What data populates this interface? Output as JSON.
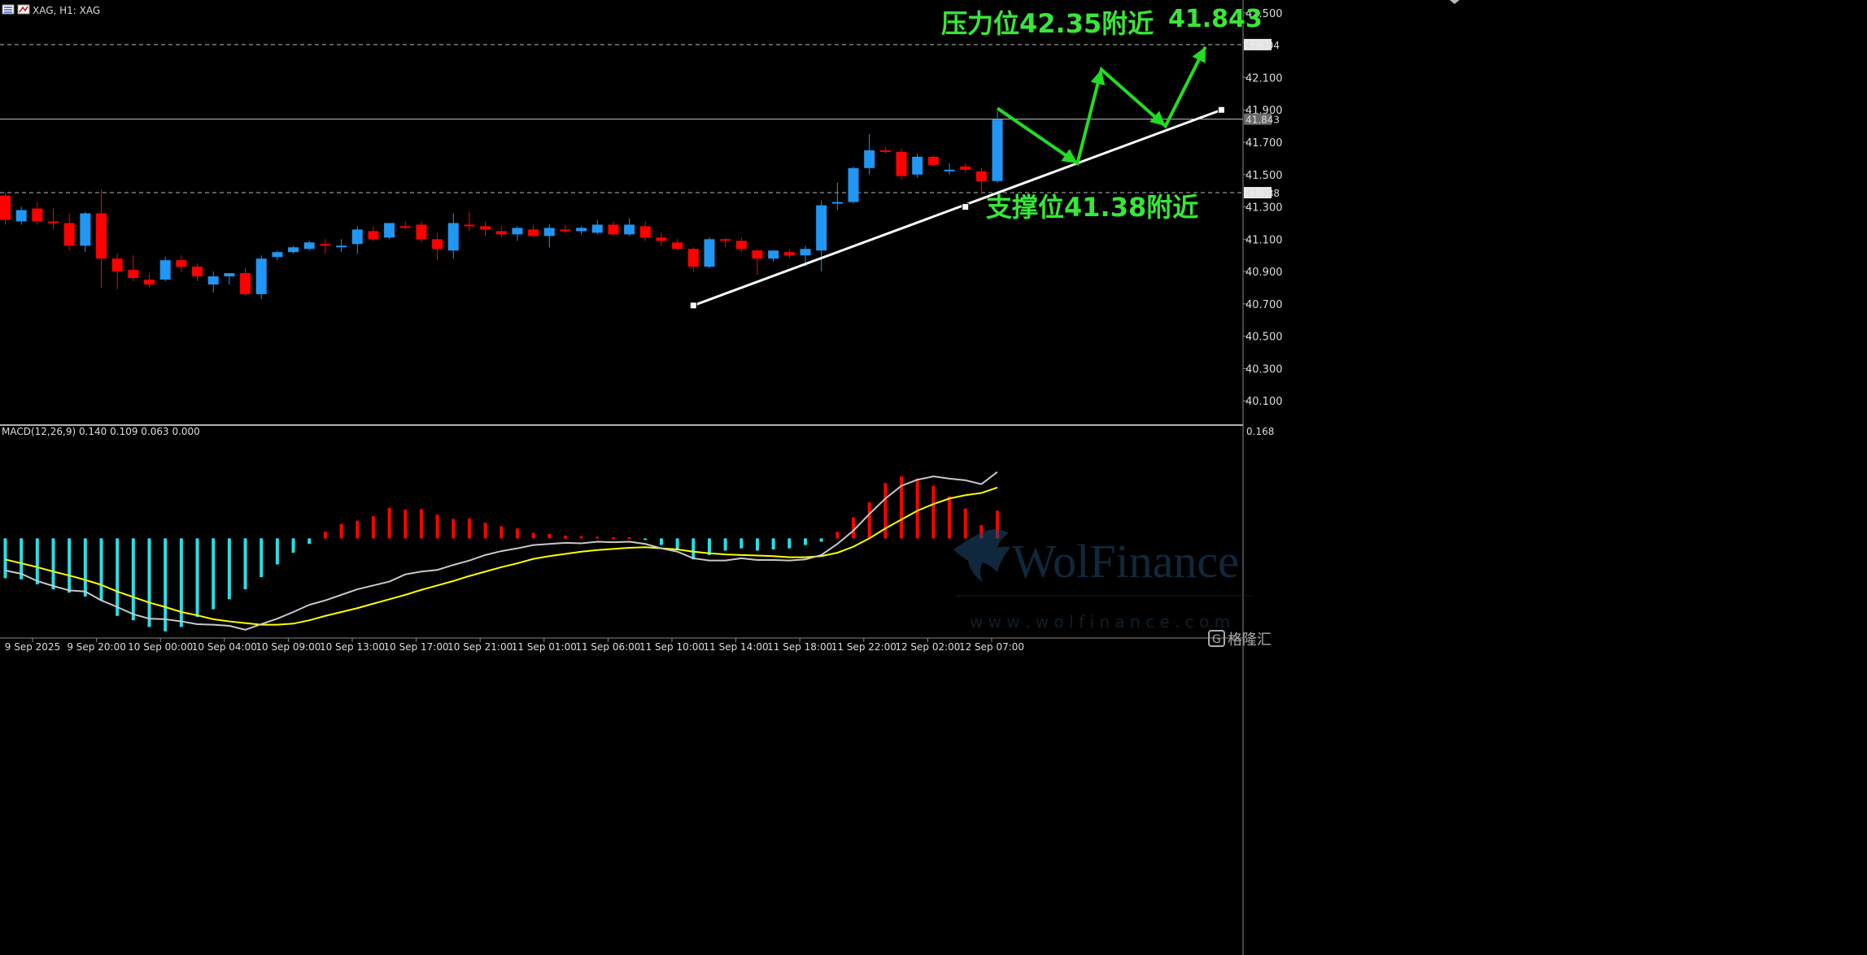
{
  "header": {
    "symbol_label": "XAG, H1: XAG"
  },
  "indicator": {
    "label": "MACD(12,26,9) 0.140 0.109 0.063 0.000",
    "axis_max_label": "0.168"
  },
  "watermark": {
    "brand": "WolFinance",
    "url": "w w w . w o l f i n a n c e . c o m",
    "corner_logo": "格隆汇"
  },
  "annotations": {
    "resistance": "压力位42.35附近",
    "support": "支撑位41.38附近",
    "target": "41.843"
  },
  "colors": {
    "bull": "#2196f3",
    "bear": "#ff0000",
    "macd_hist_pos": "#ff0000",
    "macd_hist_neg": "#26e0e8",
    "macd_line": "#c8c8c8",
    "signal_line": "#ffff00",
    "annotation_green": "#39e639",
    "arrow_green": "#22dd22"
  },
  "chart_data": {
    "type": "candlestick",
    "price_axis": {
      "range": [
        39.95,
        42.58
      ],
      "ticks": [
        "42.500",
        "42.100",
        "41.900",
        "41.700",
        "41.500",
        "41.300",
        "41.100",
        "40.900",
        "40.700",
        "40.500",
        "40.300",
        "40.100"
      ]
    },
    "price_markers": [
      {
        "value": 42.304,
        "label": "42.304",
        "style": "dashed"
      },
      {
        "value": 41.843,
        "label": "41.843",
        "style": "solid"
      },
      {
        "value": 41.388,
        "label": "41.388",
        "style": "dashed"
      }
    ],
    "time_labels": [
      "9 Sep 2025",
      "9 Sep 20:00",
      "10 Sep 00:00",
      "10 Sep 04:00",
      "10 Sep 09:00",
      "10 Sep 13:00",
      "10 Sep 17:00",
      "10 Sep 21:00",
      "11 Sep 01:00",
      "11 Sep 06:00",
      "11 Sep 10:00",
      "11 Sep 14:00",
      "11 Sep 18:00",
      "11 Sep 22:00",
      "12 Sep 02:00",
      "12 Sep 07:00"
    ],
    "candles": [
      [
        41.37,
        41.39,
        41.19,
        41.22
      ],
      [
        41.21,
        41.3,
        41.19,
        41.28
      ],
      [
        41.29,
        41.33,
        41.19,
        41.21
      ],
      [
        41.21,
        41.29,
        41.16,
        41.2
      ],
      [
        41.2,
        41.26,
        41.03,
        41.06
      ],
      [
        41.06,
        41.27,
        41.02,
        41.26
      ],
      [
        41.26,
        41.41,
        40.8,
        40.98
      ],
      [
        40.98,
        41.01,
        40.79,
        40.9
      ],
      [
        40.91,
        41.0,
        40.84,
        40.86
      ],
      [
        40.85,
        40.89,
        40.8,
        40.82
      ],
      [
        40.85,
        40.99,
        40.84,
        40.97
      ],
      [
        40.97,
        41.0,
        40.9,
        40.93
      ],
      [
        40.93,
        40.95,
        40.84,
        40.87
      ],
      [
        40.82,
        40.9,
        40.77,
        40.87
      ],
      [
        40.87,
        40.89,
        40.82,
        40.89
      ],
      [
        40.89,
        40.92,
        40.75,
        40.76
      ],
      [
        40.76,
        41.0,
        40.73,
        40.98
      ],
      [
        40.99,
        41.03,
        40.97,
        41.02
      ],
      [
        41.02,
        41.06,
        41.01,
        41.05
      ],
      [
        41.04,
        41.09,
        41.03,
        41.08
      ],
      [
        41.07,
        41.1,
        41.01,
        41.06
      ],
      [
        41.06,
        41.1,
        41.02,
        41.06
      ],
      [
        41.07,
        41.18,
        41.01,
        41.16
      ],
      [
        41.15,
        41.18,
        41.09,
        41.1
      ],
      [
        41.11,
        41.2,
        41.1,
        41.2
      ],
      [
        41.18,
        41.21,
        41.16,
        41.17
      ],
      [
        41.19,
        41.21,
        41.08,
        41.1
      ],
      [
        41.1,
        41.14,
        40.97,
        41.04
      ],
      [
        41.03,
        41.26,
        40.98,
        41.2
      ],
      [
        41.19,
        41.27,
        41.15,
        41.18
      ],
      [
        41.18,
        41.21,
        41.12,
        41.16
      ],
      [
        41.15,
        41.18,
        41.11,
        41.13
      ],
      [
        41.13,
        41.18,
        41.09,
        41.17
      ],
      [
        41.16,
        41.19,
        41.11,
        41.12
      ],
      [
        41.12,
        41.19,
        41.05,
        41.17
      ],
      [
        41.16,
        41.19,
        41.14,
        41.15
      ],
      [
        41.15,
        41.18,
        41.13,
        41.17
      ],
      [
        41.14,
        41.22,
        41.13,
        41.19
      ],
      [
        41.19,
        41.21,
        41.12,
        41.13
      ],
      [
        41.13,
        41.23,
        41.12,
        41.19
      ],
      [
        41.18,
        41.21,
        41.09,
        41.11
      ],
      [
        41.11,
        41.14,
        41.06,
        41.09
      ],
      [
        41.08,
        41.1,
        41.03,
        41.04
      ],
      [
        41.04,
        41.05,
        40.9,
        40.93
      ],
      [
        40.93,
        41.11,
        40.92,
        41.1
      ],
      [
        41.1,
        41.11,
        41.05,
        41.09
      ],
      [
        41.09,
        41.11,
        41.02,
        41.04
      ],
      [
        41.03,
        41.04,
        40.88,
        40.98
      ],
      [
        40.98,
        41.03,
        40.96,
        41.03
      ],
      [
        41.02,
        41.04,
        40.98,
        41.0
      ],
      [
        41.0,
        41.06,
        40.93,
        41.04
      ],
      [
        41.03,
        41.34,
        40.9,
        41.31
      ],
      [
        41.32,
        41.45,
        41.28,
        41.33
      ],
      [
        41.33,
        41.55,
        41.32,
        41.54
      ],
      [
        41.54,
        41.75,
        41.5,
        41.65
      ],
      [
        41.65,
        41.67,
        41.63,
        41.64
      ],
      [
        41.64,
        41.66,
        41.47,
        41.49
      ],
      [
        41.5,
        41.63,
        41.48,
        41.61
      ],
      [
        41.61,
        41.62,
        41.55,
        41.56
      ],
      [
        41.53,
        41.57,
        41.5,
        41.53
      ],
      [
        41.55,
        41.57,
        41.51,
        41.53
      ],
      [
        41.52,
        41.54,
        41.38,
        41.46
      ],
      [
        41.46,
        41.89,
        41.45,
        41.84
      ]
    ],
    "trend_line": {
      "from": [
        43,
        40.69
      ],
      "mid": [
        60,
        41.3
      ],
      "to": [
        76,
        41.9
      ]
    },
    "forecast_path": [
      [
        62,
        41.91
      ],
      [
        67,
        41.57
      ],
      [
        68.5,
        42.15
      ],
      [
        72.5,
        41.8
      ],
      [
        75,
        42.29
      ]
    ],
    "macd": {
      "range": [
        -0.18,
        0.168
      ],
      "histogram": [
        -0.072,
        -0.074,
        -0.083,
        -0.092,
        -0.098,
        -0.105,
        -0.112,
        -0.14,
        -0.148,
        -0.16,
        -0.168,
        -0.16,
        -0.142,
        -0.128,
        -0.11,
        -0.092,
        -0.07,
        -0.047,
        -0.026,
        -0.01,
        0.012,
        0.026,
        0.032,
        0.04,
        0.055,
        0.052,
        0.053,
        0.043,
        0.035,
        0.036,
        0.028,
        0.022,
        0.018,
        0.01,
        0.008,
        0.005,
        0.004,
        0.003,
        0.002,
        0.002,
        -0.002,
        -0.012,
        -0.02,
        -0.038,
        -0.03,
        -0.022,
        -0.018,
        -0.022,
        -0.02,
        -0.018,
        -0.012,
        -0.006,
        0.012,
        0.038,
        0.065,
        0.1,
        0.112,
        0.108,
        0.095,
        0.076,
        0.054,
        0.024,
        0.05
      ],
      "macd_line": [
        -0.058,
        -0.064,
        -0.077,
        -0.086,
        -0.094,
        -0.096,
        -0.112,
        -0.124,
        -0.137,
        -0.145,
        -0.146,
        -0.15,
        -0.155,
        -0.156,
        -0.158,
        -0.165,
        -0.155,
        -0.145,
        -0.133,
        -0.12,
        -0.112,
        -0.102,
        -0.092,
        -0.085,
        -0.078,
        -0.065,
        -0.06,
        -0.057,
        -0.048,
        -0.04,
        -0.03,
        -0.023,
        -0.018,
        -0.012,
        -0.01,
        -0.008,
        -0.009,
        -0.006,
        -0.007,
        -0.006,
        -0.01,
        -0.018,
        -0.024,
        -0.036,
        -0.04,
        -0.04,
        -0.036,
        -0.039,
        -0.039,
        -0.04,
        -0.038,
        -0.03,
        -0.01,
        0.014,
        0.044,
        0.072,
        0.095,
        0.106,
        0.112,
        0.108,
        0.105,
        0.098,
        0.12
      ],
      "signal_line": [
        -0.038,
        -0.045,
        -0.052,
        -0.06,
        -0.067,
        -0.075,
        -0.084,
        -0.096,
        -0.106,
        -0.116,
        -0.124,
        -0.133,
        -0.139,
        -0.146,
        -0.15,
        -0.153,
        -0.156,
        -0.156,
        -0.154,
        -0.148,
        -0.14,
        -0.133,
        -0.126,
        -0.118,
        -0.11,
        -0.102,
        -0.093,
        -0.085,
        -0.077,
        -0.068,
        -0.06,
        -0.052,
        -0.045,
        -0.037,
        -0.032,
        -0.028,
        -0.024,
        -0.021,
        -0.019,
        -0.017,
        -0.016,
        -0.018,
        -0.02,
        -0.024,
        -0.027,
        -0.029,
        -0.03,
        -0.031,
        -0.032,
        -0.034,
        -0.034,
        -0.032,
        -0.026,
        -0.015,
        0.0,
        0.018,
        0.034,
        0.05,
        0.062,
        0.072,
        0.078,
        0.082,
        0.092
      ]
    }
  }
}
